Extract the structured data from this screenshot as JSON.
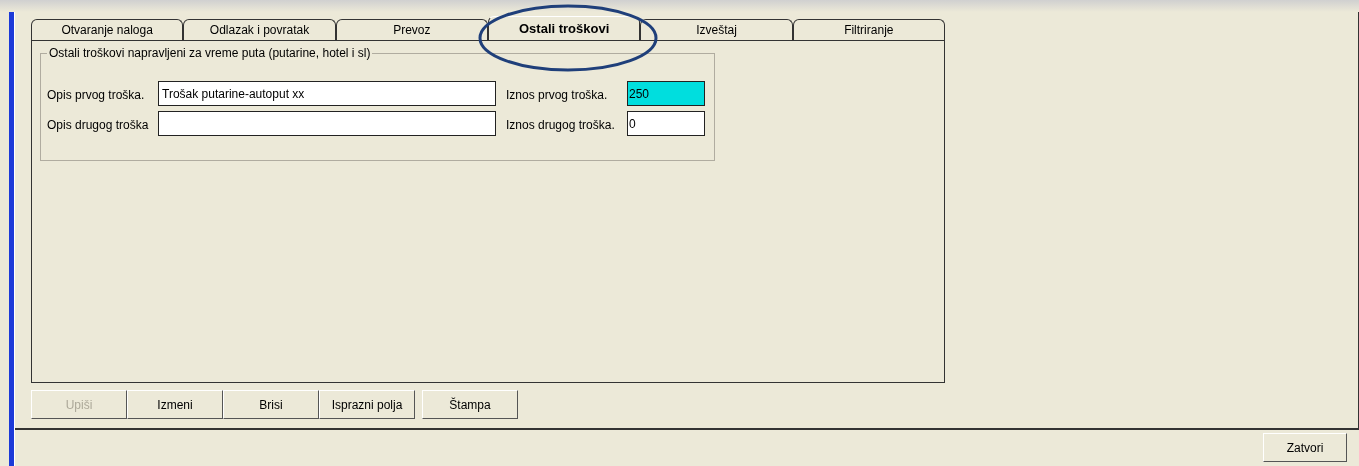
{
  "tabs": [
    {
      "label": "Otvaranje naloga",
      "selected": false
    },
    {
      "label": "Odlazak i povratak",
      "selected": false
    },
    {
      "label": "Prevoz",
      "selected": false
    },
    {
      "label": "Ostali troškovi",
      "selected": true
    },
    {
      "label": "Izveštaj",
      "selected": false
    },
    {
      "label": "Filtriranje",
      "selected": false
    }
  ],
  "group": {
    "title": "Ostali troškovi napravljeni za vreme puta (putarine, hotel i sl)",
    "rows": [
      {
        "label": "Opis prvog troška.",
        "value": "Trošak putarine-autoput xx",
        "amount_label": "Iznos prvog troška.",
        "amount": "250",
        "amount_focused": true
      },
      {
        "label": "Opis drugog troška",
        "value": "",
        "amount_label": "Iznos drugog troška.",
        "amount": "0",
        "amount_focused": false
      }
    ]
  },
  "buttons": [
    {
      "label": "Upiši",
      "disabled": true
    },
    {
      "label": "Izmeni",
      "disabled": false
    },
    {
      "label": "Brisi",
      "disabled": false
    },
    {
      "label": "Isprazni polja",
      "disabled": false
    },
    {
      "label": "Štampa",
      "disabled": false
    }
  ],
  "close_button": {
    "label": "Zatvori"
  }
}
